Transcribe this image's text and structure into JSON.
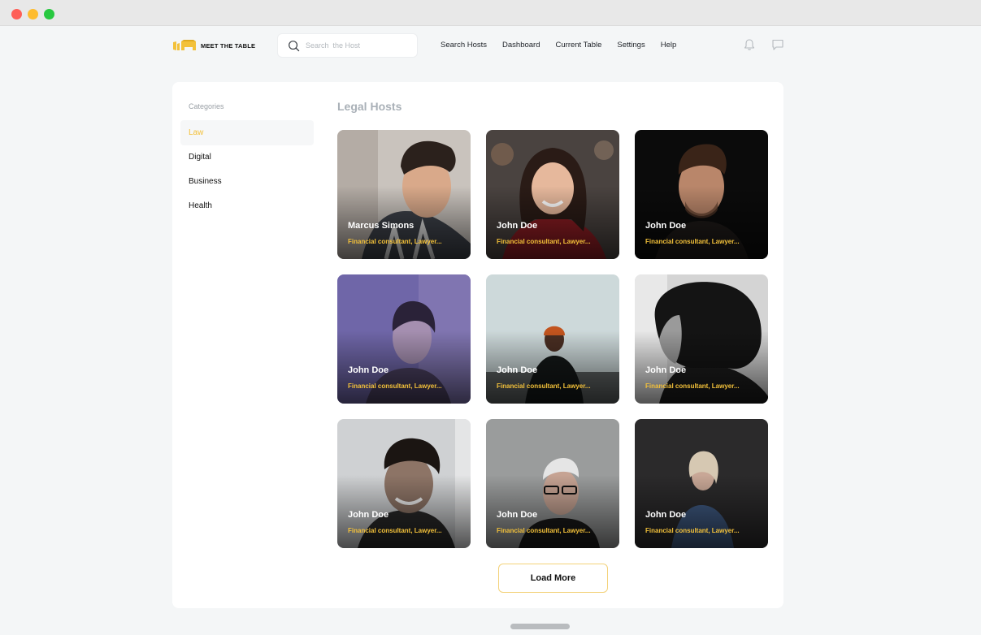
{
  "brand": {
    "name": "MEET THE TABLE",
    "accent": "#f3c13a"
  },
  "search": {
    "placeholder": "Search  the Host",
    "value": ""
  },
  "nav": {
    "items": [
      {
        "label": "Search Hosts"
      },
      {
        "label": "Dashboard"
      },
      {
        "label": "Current Table"
      },
      {
        "label": "Settings"
      },
      {
        "label": "Help"
      }
    ],
    "icons": [
      "bell-icon",
      "chat-icon"
    ]
  },
  "sidebar": {
    "title": "Categories",
    "items": [
      {
        "label": "Law",
        "active": true
      },
      {
        "label": "Digital",
        "active": false
      },
      {
        "label": "Business",
        "active": false
      },
      {
        "label": "Health",
        "active": false
      }
    ]
  },
  "main": {
    "title": "Legal Hosts",
    "hosts": [
      {
        "name": "Marcus Simons",
        "role": "Financial consultant, Lawyer..."
      },
      {
        "name": "John Doe",
        "role": "Financial consultant, Lawyer..."
      },
      {
        "name": "John Doe",
        "role": "Financial consultant, Lawyer..."
      },
      {
        "name": "John Doe",
        "role": "Financial consultant, Lawyer..."
      },
      {
        "name": "John Doe",
        "role": "Financial consultant, Lawyer..."
      },
      {
        "name": "John Doe",
        "role": "Financial consultant, Lawyer..."
      },
      {
        "name": "John Doe",
        "role": "Financial consultant, Lawyer..."
      },
      {
        "name": "John Doe",
        "role": "Financial consultant, Lawyer..."
      },
      {
        "name": "John Doe",
        "role": "Financial consultant, Lawyer..."
      }
    ],
    "load_more_label": "Load More"
  }
}
